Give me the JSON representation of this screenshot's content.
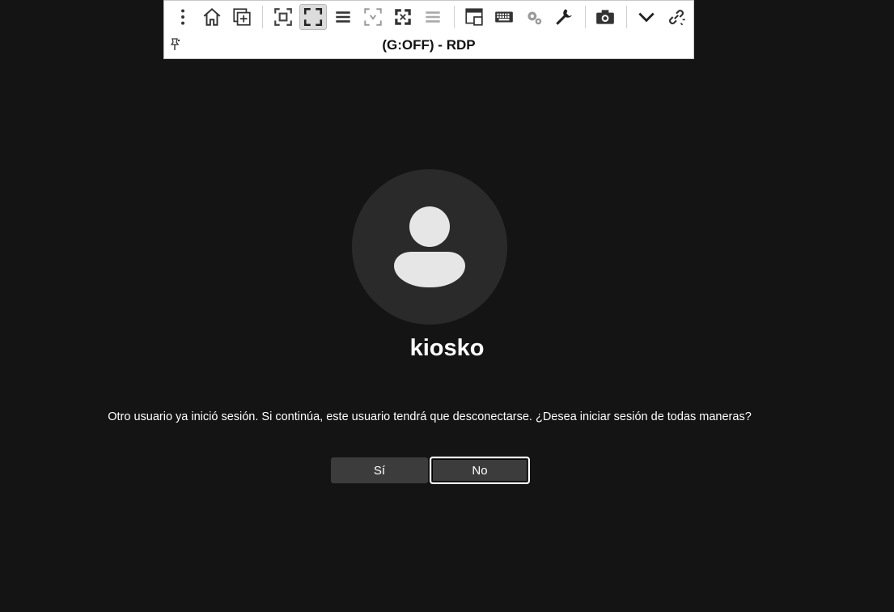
{
  "rdp_toolbar": {
    "title": "(G:OFF) - RDP",
    "tools": [
      {
        "name": "menu-dots-icon"
      },
      {
        "name": "home-icon"
      },
      {
        "name": "new-window-icon"
      },
      {
        "name": "fit-window-icon"
      },
      {
        "name": "fullscreen-icon",
        "active": true
      },
      {
        "name": "hamburger-icon"
      },
      {
        "name": "scale-icon"
      },
      {
        "name": "expand-icon"
      },
      {
        "name": "list-icon"
      },
      {
        "name": "multi-monitor-icon"
      },
      {
        "name": "keyboard-icon"
      },
      {
        "name": "settings-gears-icon"
      },
      {
        "name": "wrench-icon"
      },
      {
        "name": "camera-icon"
      },
      {
        "name": "chevron-down-icon"
      },
      {
        "name": "disconnect-link-icon"
      }
    ]
  },
  "login": {
    "username": "kiosko",
    "message": "Otro usuario ya inició sesión. Si continúa, este usuario tendrá que desconectarse. ¿Desea iniciar sesión de todas maneras?",
    "yes_label": "Sí",
    "no_label": "No"
  },
  "colors": {
    "background": "#141414",
    "avatar_bg": "#2a2a2a",
    "button_bg": "#3c3c3c",
    "toolbar_bg": "#ffffff"
  }
}
